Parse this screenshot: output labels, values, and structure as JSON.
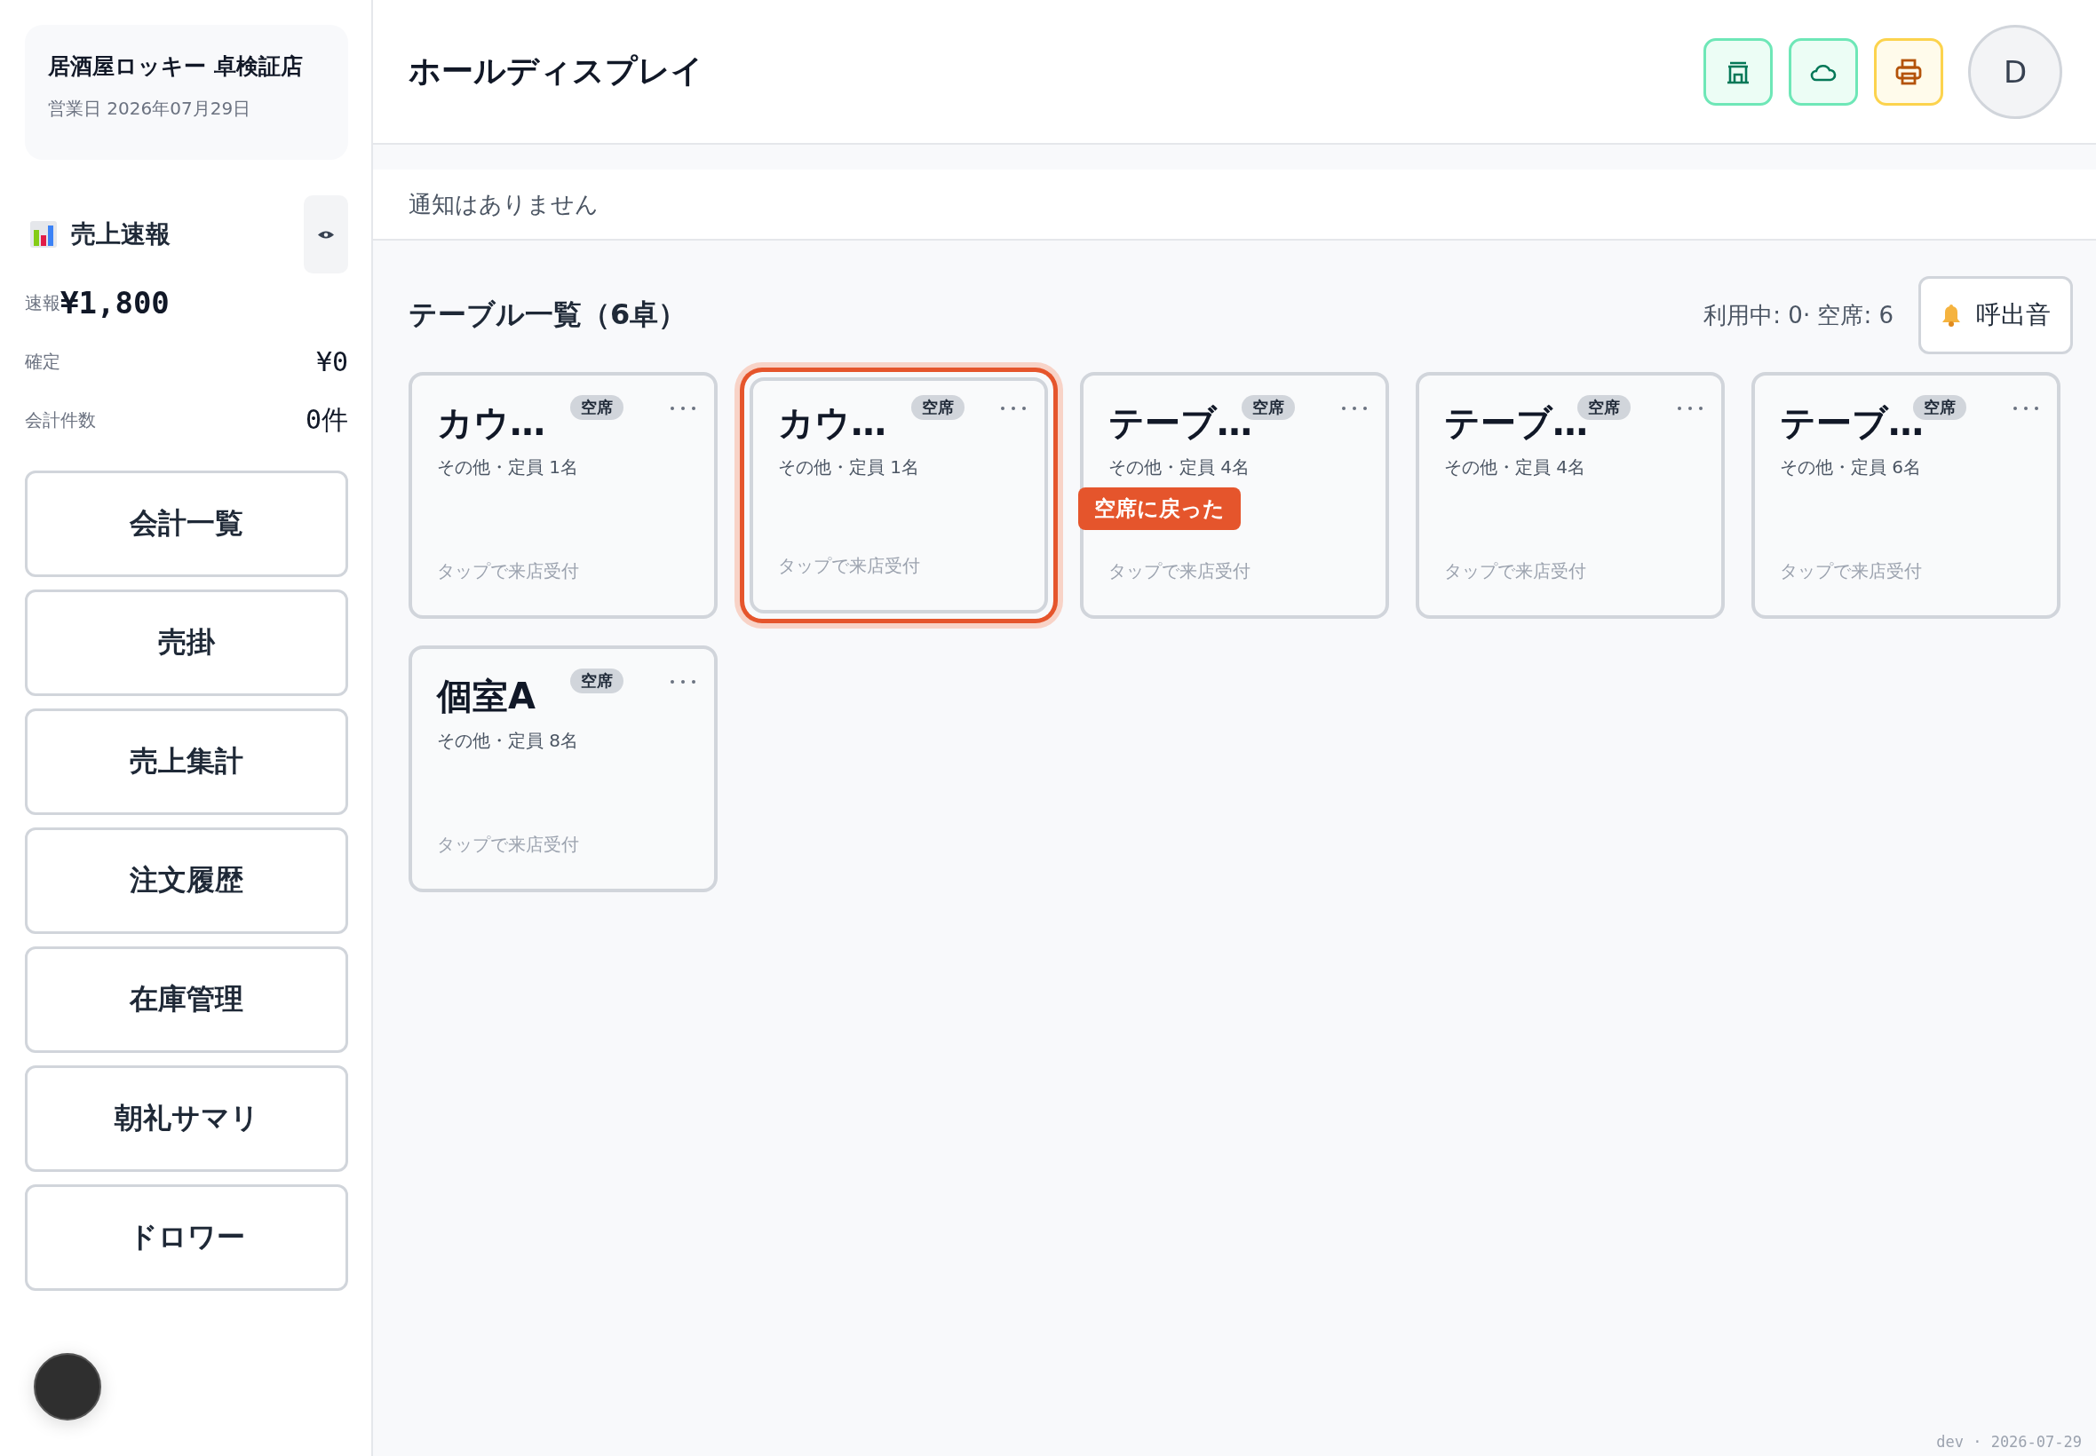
{
  "sidebar": {
    "store_name": "居酒屋ロッキー 卓検証店",
    "business_date": "営業日 2026年07月29日",
    "sales": {
      "title": "売上速報",
      "rows": [
        {
          "label": "速報",
          "value": "¥1,800",
          "kind": "main"
        },
        {
          "label": "確定",
          "value": "¥0",
          "kind": "sub"
        },
        {
          "label": "会計件数",
          "value": "0件",
          "kind": "sub"
        }
      ]
    },
    "nav": [
      "会計一覧",
      "売掛",
      "売上集計",
      "注文履歴",
      "在庫管理",
      "朝礼サマリ",
      "ドロワー"
    ]
  },
  "header": {
    "title": "ホールディスプレイ",
    "status_buttons": [
      {
        "kind": "store",
        "color": "#047857"
      },
      {
        "kind": "cloud",
        "color": "#047857"
      },
      {
        "kind": "printer",
        "color": "#b45309"
      }
    ],
    "avatar": "D"
  },
  "notification": "通知はありません",
  "tables_section": {
    "title": "テーブル一覧（6卓）",
    "stats": "利用中: 0· 空席: 6",
    "call_sound_button": "呼出音",
    "tables": [
      {
        "name": "カウ…",
        "status": "空席",
        "info": "その他・定員 1名",
        "hint": "タップで来店受付",
        "highlighted": false
      },
      {
        "name": "カウ…",
        "status": "空席",
        "info": "その他・定員 1名",
        "hint": "タップで来店受付",
        "highlighted": true,
        "toast": "空席に戻った"
      },
      {
        "name": "テーブ…",
        "status": "空席",
        "info": "その他・定員 4名",
        "hint": "タップで来店受付",
        "highlighted": false
      },
      {
        "name": "テーブ…",
        "status": "空席",
        "info": "その他・定員 4名",
        "hint": "タップで来店受付",
        "highlighted": false
      },
      {
        "name": "テーブ…",
        "status": "空席",
        "info": "その他・定員 6名",
        "hint": "タップで来店受付",
        "highlighted": false
      },
      {
        "name": "個室A",
        "status": "空席",
        "info": "その他・定員 8名",
        "hint": "タップで来店受付",
        "highlighted": false
      }
    ]
  },
  "footer": "dev · 2026-07-29"
}
